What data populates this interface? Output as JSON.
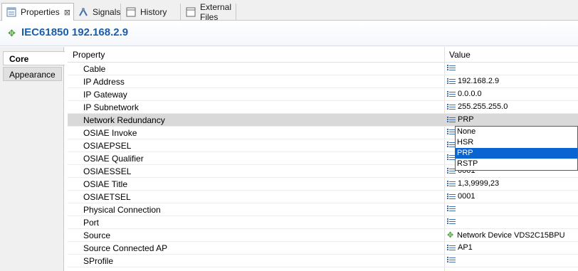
{
  "tabs": [
    {
      "label": "Properties",
      "close": "⊠",
      "icon": "properties-icon"
    },
    {
      "label": "Signals",
      "icon": "signals-icon"
    },
    {
      "label": "History",
      "icon": "history-icon"
    },
    {
      "label": "External Files",
      "icon": "external-files-icon"
    }
  ],
  "title": {
    "text": "IEC61850 192.168.2.9",
    "icon": "device-diamond-icon"
  },
  "side_tabs": [
    "Core",
    "Appearance"
  ],
  "table": {
    "headers": {
      "property": "Property",
      "value": "Value"
    },
    "rows": [
      {
        "property": "Cable",
        "value": ""
      },
      {
        "property": "IP Address",
        "value": "192.168.2.9"
      },
      {
        "property": "IP Gateway",
        "value": "0.0.0.0"
      },
      {
        "property": "IP Subnetwork",
        "value": "255.255.255.0"
      },
      {
        "property": "Network Redundancy",
        "value": "PRP"
      },
      {
        "property": "OSIAE Invoke",
        "value": ""
      },
      {
        "property": "OSIAEPSEL",
        "value": ""
      },
      {
        "property": "OSIAE Qualifier",
        "value": ""
      },
      {
        "property": "OSIAESSEL",
        "value": "0001"
      },
      {
        "property": "OSIAE Title",
        "value": "1,3,9999,23"
      },
      {
        "property": "OSIAETSEL",
        "value": "0001"
      },
      {
        "property": "Physical Connection",
        "value": ""
      },
      {
        "property": "Port",
        "value": ""
      },
      {
        "property": "Source",
        "value": "Network Device VDS2C15BPU"
      },
      {
        "property": "Source Connected AP",
        "value": "AP1"
      },
      {
        "property": "SProfile",
        "value": ""
      }
    ]
  },
  "dropdown": {
    "options": [
      "None",
      "HSR",
      "PRP",
      "RSTP"
    ],
    "selected": "PRP"
  },
  "colors": {
    "title": "#1b5ea8",
    "selection": "#0a64d2",
    "row_highlight": "#d9d9d9",
    "icon_green": "#4d9a3a"
  }
}
